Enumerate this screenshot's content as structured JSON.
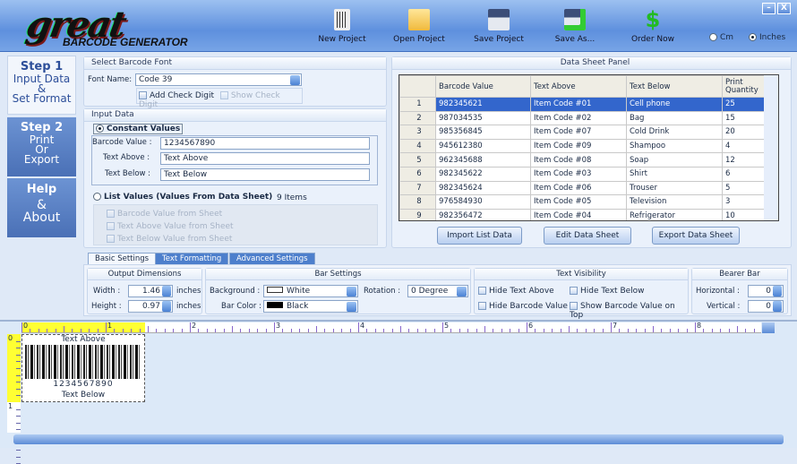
{
  "app": {
    "logo_main": "great",
    "logo_sub": "BARCODE GENERATOR"
  },
  "toolbar": [
    {
      "label": "New Project",
      "icon": "new-project-icon"
    },
    {
      "label": "Open Project",
      "icon": "folder-icon"
    },
    {
      "label": "Save Project",
      "icon": "floppy-icon"
    },
    {
      "label": "Save As...",
      "icon": "floppy-plus-icon"
    },
    {
      "label": "Order Now",
      "icon": "dollar-icon"
    }
  ],
  "units": {
    "cm": "Cm",
    "inches": "Inches",
    "selected": "Inches"
  },
  "window": {
    "minimize": "–",
    "close": "X"
  },
  "nav": [
    {
      "title": "Step 1",
      "sub1": "Input Data",
      "sub2": "&",
      "sub3": "Set Format",
      "active": true
    },
    {
      "title": "Step 2",
      "sub1": "Print",
      "sub2": "Or",
      "sub3": "Export",
      "active": false
    },
    {
      "title": "Help",
      "sub1": "&",
      "sub2": "About",
      "active": false
    }
  ],
  "font_panel": {
    "title": "Select Barcode Font",
    "font_label": "Font Name:",
    "font_value": "Code 39",
    "add_check": "Add Check Digit",
    "show_check": "Show Check Digit"
  },
  "input_panel": {
    "title": "Input Data",
    "constant": "Constant Values",
    "barcode_label": "Barcode Value :",
    "barcode_value": "1234567890",
    "above_label": "Text Above :",
    "above_value": "Text Above",
    "below_label": "Text Below :",
    "below_value": "Text Below",
    "list": "List Values (Values From Data Sheet)",
    "items": "9 Items",
    "from_barcode": "Barcode Value from Sheet",
    "from_above": "Text Above Value from Sheet",
    "from_below": "Text Below Value from Sheet"
  },
  "sheet": {
    "title": "Data Sheet Panel",
    "columns": [
      "Barcode Value",
      "Text Above",
      "Text Below",
      "Print Quantity"
    ],
    "rows": [
      [
        "1",
        "982345621",
        "Item Code #01",
        "Cell phone",
        "25"
      ],
      [
        "2",
        "987034535",
        "Item Code #02",
        "Bag",
        "15"
      ],
      [
        "3",
        "985356845",
        "Item Code #07",
        "Cold Drink",
        "20"
      ],
      [
        "4",
        "945612380",
        "Item Code #09",
        "Shampoo",
        "4"
      ],
      [
        "5",
        "962345688",
        "Item Code #08",
        "Soap",
        "12"
      ],
      [
        "6",
        "982345622",
        "Item Code #03",
        "Shirt",
        "6"
      ],
      [
        "7",
        "982345624",
        "Item Code #06",
        "Trouser",
        "5"
      ],
      [
        "8",
        "976584930",
        "Item Code #05",
        "Television",
        "3"
      ],
      [
        "9",
        "982356472",
        "Item Code #04",
        "Refrigerator",
        "10"
      ]
    ],
    "import": "Import List Data",
    "edit": "Edit Data Sheet",
    "export": "Export Data Sheet"
  },
  "tabs": [
    "Basic Settings",
    "Text Formatting",
    "Advanced Settings"
  ],
  "settings": {
    "dims_title": "Output Dimensions",
    "width_label": "Width :",
    "width": "1.46",
    "height_label": "Height :",
    "height": "0.97",
    "unit": "inches",
    "bar_title": "Bar Settings",
    "bg_label": "Background :",
    "bg": "White",
    "color_label": "Bar Color :",
    "color": "Black",
    "rot_label": "Rotation :",
    "rot": "0 Degree",
    "vis_title": "Text Visibility",
    "hide_above": "Hide Text Above",
    "hide_below": "Hide Text Below",
    "hide_value": "Hide Barcode Value",
    "show_top": "Show Barcode Value on Top",
    "bearer_title": "Bearer Bar",
    "horiz_label": "Horizontal :",
    "horiz": "0",
    "vert_label": "Vertical :",
    "vert": "0"
  },
  "ruler": {
    "h": [
      "0",
      "1",
      "2",
      "3",
      "4",
      "5",
      "6",
      "7",
      "8"
    ],
    "v": [
      "0",
      "1"
    ]
  },
  "preview": {
    "above": "Text Above",
    "value": "1234567890",
    "below": "Text Below"
  },
  "colors": {
    "accent": "#3366cc",
    "nav_dark": "#4f78bd",
    "ruler_highlight": "#ffff33"
  }
}
